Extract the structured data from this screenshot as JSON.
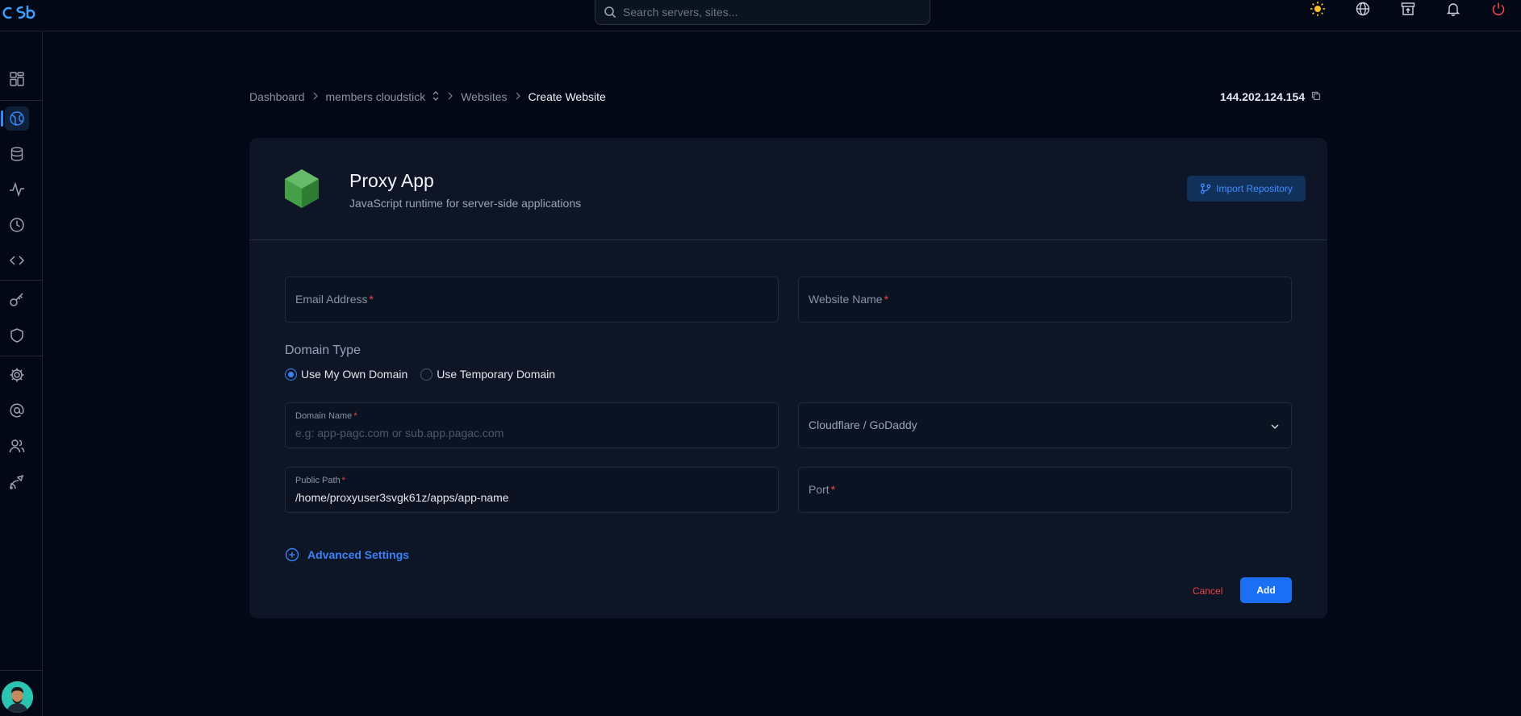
{
  "topbar": {
    "search_placeholder": "Search servers, sites...",
    "icons": [
      "sun-icon",
      "globe-icon",
      "upload-box-icon",
      "bell-icon",
      "power-icon"
    ]
  },
  "sidebar": {
    "items": [
      "dashboard-icon",
      "websites-icon",
      "database-icon",
      "activity-icon",
      "clock-icon",
      "code-icon",
      "key-icon",
      "shield-icon",
      "settings-icon",
      "at-icon",
      "users-icon",
      "deploy-icon"
    ],
    "active": "websites-icon"
  },
  "breadcrumb": {
    "items": [
      "Dashboard",
      "members cloudstick",
      "Websites"
    ],
    "current": "Create Website"
  },
  "server_ip": "144.202.124.154",
  "app": {
    "title": "Proxy App",
    "subtitle": "JavaScript runtime for server-side applications",
    "import_label": "Import Repository"
  },
  "form": {
    "email_label": "Email Address",
    "website_name_label": "Website Name",
    "domain_type_label": "Domain Type",
    "domain_options": [
      "Use My Own Domain",
      "Use Temporary Domain"
    ],
    "domain_selected": "Use My Own Domain",
    "domain_name_label": "Domain Name",
    "domain_name_placeholder": "e.g: app-pagc.com or sub.app.pagac.com",
    "dns_provider": "Cloudflare / GoDaddy",
    "public_path_label": "Public Path",
    "public_path_value": "/home/proxyuser3svgk61z/apps/app-name",
    "port_label": "Port",
    "required_mark": "*",
    "advanced_label": "Advanced Settings",
    "cancel_label": "Cancel",
    "add_label": "Add"
  },
  "colors": {
    "background": "#030816",
    "card": "#0d1526",
    "accent": "#1a6ff5",
    "danger": "#ef4444"
  }
}
